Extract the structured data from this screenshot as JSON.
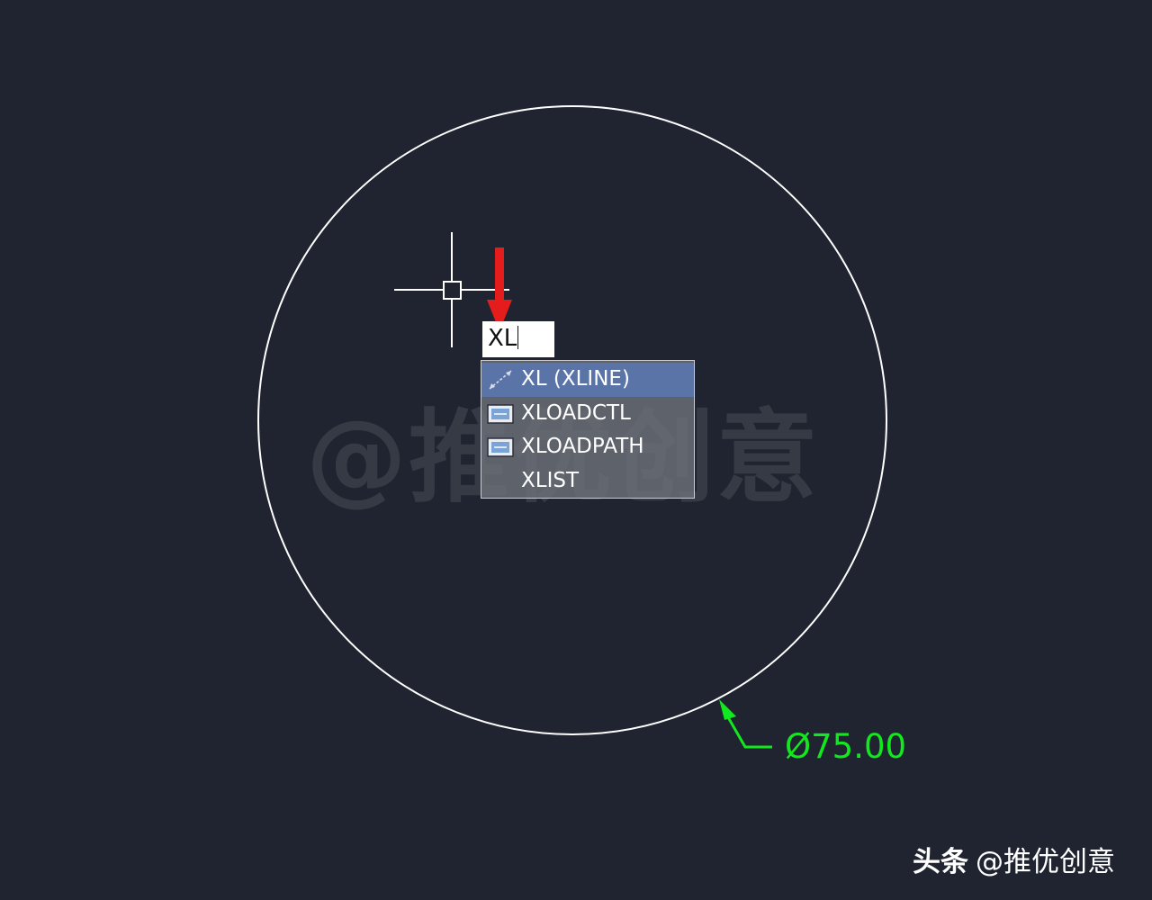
{
  "watermark": {
    "text": "@推优创意"
  },
  "command_input": {
    "value": "XL"
  },
  "autocomplete": {
    "items": [
      {
        "label": "XL (XLINE)",
        "icon": "xline-icon",
        "selected": true
      },
      {
        "label": "XLOADCTL",
        "icon": "xref-load-icon",
        "selected": false
      },
      {
        "label": "XLOADPATH",
        "icon": "xref-load-icon",
        "selected": false
      },
      {
        "label": "XLIST",
        "icon": "",
        "selected": false
      }
    ]
  },
  "dimension": {
    "text": "Ø75.00"
  },
  "footer": {
    "platform": "头条",
    "handle": "@推优创意"
  },
  "colors": {
    "background": "#1f2430",
    "circle": "#ffffff",
    "dimension": "#11e81d",
    "arrow": "#e51c1c",
    "selection": "#5b74a8"
  }
}
